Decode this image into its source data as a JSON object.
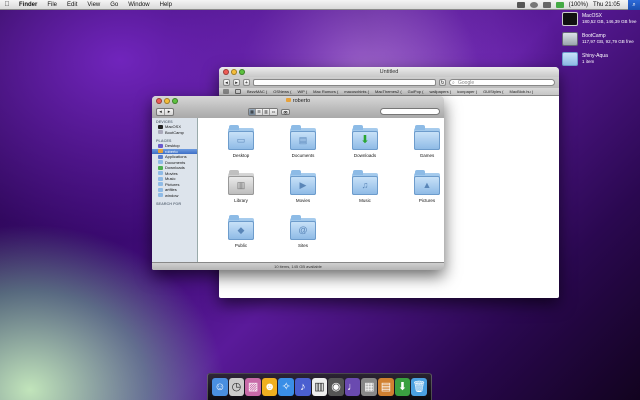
{
  "menubar": {
    "app_name": "Finder",
    "items": [
      "File",
      "Edit",
      "View",
      "Go",
      "Window",
      "Help"
    ],
    "battery": "(100%)",
    "clock": "Thu 21:05",
    "spotlight_glyph": "⌕"
  },
  "desktop": {
    "disks": [
      {
        "name": "MacOSX",
        "detail": "180,52 GB, 146,39 GB free",
        "icon": "monitor-icon",
        "color": "#1a1a1a"
      },
      {
        "name": "BootCamp",
        "detail": "117,97 GB, 92,79 GB free",
        "icon": "hard-drive-icon",
        "color": "#b8c2cc"
      },
      {
        "name": "Shiny-Aqua",
        "detail": "1 item",
        "icon": "folder-icon",
        "color": "#8fbbe6"
      }
    ]
  },
  "safari": {
    "title": "Untitled",
    "back": "◂",
    "forward": "▸",
    "add": "+",
    "reload": "↻",
    "search_placeholder": "Google",
    "bookmarks": [
      "BezzMAC (",
      "OSNews (",
      "WiP (",
      "Mac Rumors (",
      "macosxhints (",
      "MacThemes2 (",
      "GuiPop (",
      "wallpapers (",
      "iconpaper (",
      "GUIStyles (",
      "MacBlob.hu ("
    ]
  },
  "finder": {
    "title": "roberto",
    "back": "◂",
    "forward": "▸",
    "view_icons": [
      "▦",
      "☰",
      "▥",
      "▭"
    ],
    "quicklook": "👁",
    "sidebar": {
      "devices_header": "DEVICES",
      "devices": [
        {
          "label": "MacOSX",
          "color": "#222"
        },
        {
          "label": "BootCamp",
          "color": "#aab"
        }
      ],
      "places_header": "PLACES",
      "places": [
        {
          "label": "Desktop",
          "color": "#6a5acd",
          "selected": false
        },
        {
          "label": "roberto",
          "color": "#e8a23a",
          "selected": true
        },
        {
          "label": "Applications",
          "color": "#5a7fcf",
          "selected": false
        },
        {
          "label": "Documents",
          "color": "#8fbbe6",
          "selected": false
        },
        {
          "label": "Downloads",
          "color": "#4caf50",
          "selected": false
        },
        {
          "label": "Movies",
          "color": "#8fbbe6",
          "selected": false
        },
        {
          "label": "Music",
          "color": "#8fbbe6",
          "selected": false
        },
        {
          "label": "Pictures",
          "color": "#8fbbe6",
          "selected": false
        },
        {
          "label": "artfiles",
          "color": "#8fbbe6",
          "selected": false
        },
        {
          "label": "window",
          "color": "#8fbbe6",
          "selected": false
        }
      ],
      "search_header": "SEARCH FOR"
    },
    "items": [
      {
        "label": "Desktop",
        "glyph": "▭",
        "style": "blue",
        "icon": "desktop-folder-icon"
      },
      {
        "label": "Documents",
        "glyph": "▤",
        "style": "blue",
        "icon": "documents-folder-icon"
      },
      {
        "label": "Downloads",
        "glyph": "⬇",
        "style": "green",
        "icon": "downloads-folder-icon"
      },
      {
        "label": "Games",
        "glyph": "",
        "style": "blue",
        "icon": "games-folder-icon"
      },
      {
        "label": "Library",
        "glyph": "▥",
        "style": "gray",
        "icon": "library-folder-icon"
      },
      {
        "label": "Movies",
        "glyph": "▶",
        "style": "blue",
        "icon": "movies-folder-icon"
      },
      {
        "label": "Music",
        "glyph": "♫",
        "style": "blue",
        "icon": "music-folder-icon"
      },
      {
        "label": "Pictures",
        "glyph": "▲",
        "style": "blue",
        "icon": "pictures-folder-icon"
      },
      {
        "label": "Public",
        "glyph": "◆",
        "style": "blue",
        "icon": "public-folder-icon"
      },
      {
        "label": "Sites",
        "glyph": "@",
        "style": "blue",
        "icon": "sites-folder-icon"
      }
    ],
    "status": "10 items, 145 GB available"
  },
  "dock": {
    "apps": [
      {
        "name": "finder-icon",
        "glyph": "☺",
        "color": "#4a8fe0"
      },
      {
        "name": "clock-icon",
        "glyph": "◷",
        "color": "#cccccc"
      },
      {
        "name": "photos-icon",
        "glyph": "▨",
        "color": "#c86aa8"
      },
      {
        "name": "chat-icon",
        "glyph": "☻",
        "color": "#f0b020"
      },
      {
        "name": "safari-icon",
        "glyph": "✧",
        "color": "#3a8ee6"
      },
      {
        "name": "itunes-icon",
        "glyph": "♪",
        "color": "#4a5fd0"
      },
      {
        "name": "piano-icon",
        "glyph": "▥",
        "color": "#eeeeee"
      },
      {
        "name": "media-icon",
        "glyph": "◉",
        "color": "#555555"
      },
      {
        "name": "music-player-icon",
        "glyph": "♩",
        "color": "#6a4ab0"
      },
      {
        "name": "calculator-icon",
        "glyph": "▦",
        "color": "#888888"
      },
      {
        "name": "notes-icon",
        "glyph": "▤",
        "color": "#d08030"
      },
      {
        "name": "downloads-stack-icon",
        "glyph": "⬇",
        "color": "#3aa040"
      },
      {
        "name": "trash-icon",
        "glyph": "🗑",
        "color": "#4aa0e0"
      }
    ]
  }
}
